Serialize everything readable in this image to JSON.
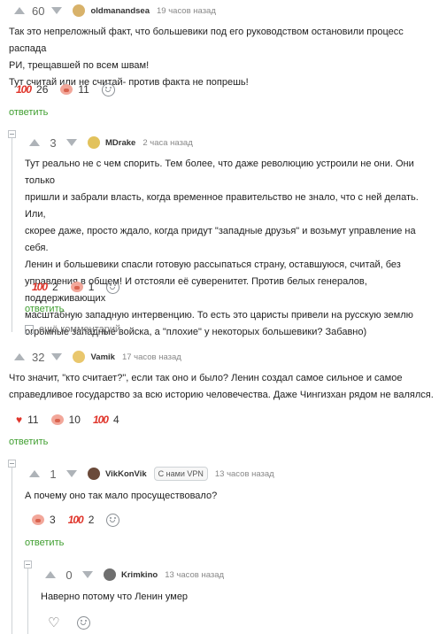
{
  "comments": [
    {
      "score": "60",
      "author": "oldmanandsea",
      "time": "19 часов назад",
      "lines": [
        "Так это непреложный факт, что большевики под его руководством остановили процесс распада",
        "РИ, трещавшей по всем швам!",
        "Тут считай или не считай- против факта не попрешь!"
      ],
      "reactions": [
        {
          "icon": "100-icon",
          "glyph": "100",
          "count": "26"
        },
        {
          "icon": "pig-icon",
          "glyph": "",
          "count": "11"
        }
      ],
      "reply_label": "ответить",
      "avatar_color": "#d8b26a"
    },
    {
      "score": "3",
      "author": "MDrake",
      "time": "2 часа назад",
      "lines": [
        "Тут реально не с чем спорить. Тем более, что даже революцию устроили не они. Они только",
        "пришли и забрали власть, когда временное правительство не знало, что с ней делать. Или,",
        "скорее даже, просто ждало, когда придут \"западные друзья\" и возьмут управление на себя.",
        "Ленин и большевики спасли готовую рассыпаться страну, оставшуюся, считай, без",
        "управления в общем! И отстояли её суверенитет. Против белых генералов, поддерживающих",
        "масштабную западную интервенцию. То есть это царисты привели на русскую землю",
        "огромные западные войска, а \"плохие\" у некоторых большевики? Забавно)"
      ],
      "reactions": [
        {
          "icon": "100-icon",
          "glyph": "100",
          "count": "2"
        },
        {
          "icon": "pig-icon",
          "glyph": "",
          "count": "1"
        }
      ],
      "reply_label": "ответить",
      "more_label": "ещё комментарий",
      "avatar_color": "#e2c25c"
    },
    {
      "score": "32",
      "author": "Vamik",
      "time": "17 часов назад",
      "lines": [
        "Что значит, \"кто считает?\", если так оно и было? Ленин создал самое сильное и самое",
        "справедливое государство за всю историю человечества. Даже Чингизхан рядом не валялся."
      ],
      "reactions": [
        {
          "icon": "heart-icon",
          "glyph": "♥",
          "count": "11"
        },
        {
          "icon": "pig-icon",
          "glyph": "",
          "count": "10"
        },
        {
          "icon": "100-icon",
          "glyph": "100",
          "count": "4"
        }
      ],
      "reply_label": "ответить",
      "avatar_color": "#e9c76d"
    },
    {
      "score": "1",
      "author": "VikKonVik",
      "badge": "С нами VPN",
      "time": "13 часов назад",
      "lines": [
        "А почему оно так мало просуществовало?"
      ],
      "reactions": [
        {
          "icon": "pig-icon",
          "glyph": "",
          "count": "3"
        },
        {
          "icon": "100-icon",
          "glyph": "100",
          "count": "2"
        }
      ],
      "reply_label": "ответить",
      "avatar_color": "#6b4a3a"
    },
    {
      "score": "0",
      "author": "Krimkino",
      "time": "13 часов назад",
      "lines": [
        "Наверно потому что Ленин умер"
      ],
      "avatar_color": "#6f6f6f"
    }
  ]
}
